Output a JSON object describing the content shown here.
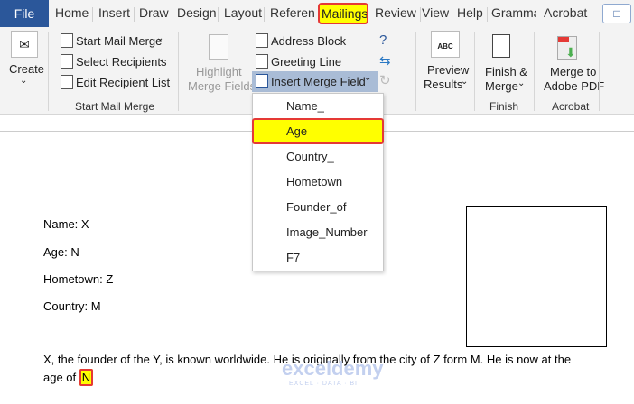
{
  "tabs": {
    "file": "File",
    "items": [
      "Home",
      "Insert",
      "Draw",
      "Design",
      "Layout",
      "Referenc",
      "Mailings",
      "Review",
      "View",
      "Help",
      "Gramma",
      "Acrobat"
    ]
  },
  "ribbon": {
    "create": "Create",
    "start_mail_merge": "Start Mail Merge",
    "select_recipients": "Select Recipients",
    "edit_recipient_list": "Edit Recipient List",
    "group_start": "Start Mail Merge",
    "highlight1": "Highlight",
    "highlight2": "Merge Fields",
    "address_block": "Address Block",
    "greeting_line": "Greeting Line",
    "insert_merge_field": "Insert Merge Field",
    "preview1": "Preview",
    "preview2": "Results",
    "preview_icon_text": "ABC",
    "finish1": "Finish &",
    "finish2": "Merge",
    "group_finish": "Finish",
    "adobe1": "Merge to",
    "adobe2": "Adobe PDF",
    "group_acrobat": "Acrobat"
  },
  "dropdown": {
    "items": [
      "Name_",
      "Age",
      "Country_",
      "Hometown",
      "Founder_of",
      "Image_Number",
      "F7"
    ],
    "selected": "Age"
  },
  "document": {
    "lines": [
      "Name: X",
      "Age: N",
      "Hometown: Z",
      "Country: M"
    ],
    "paragraph1": "X, the founder of the Y, is known worldwide. He is originally from the city of Z form M. He is now at the",
    "paragraph2_prefix": "age of ",
    "field": "N"
  },
  "watermark": {
    "name": "exceldemy",
    "tagline": "EXCEL · DATA · BI"
  }
}
